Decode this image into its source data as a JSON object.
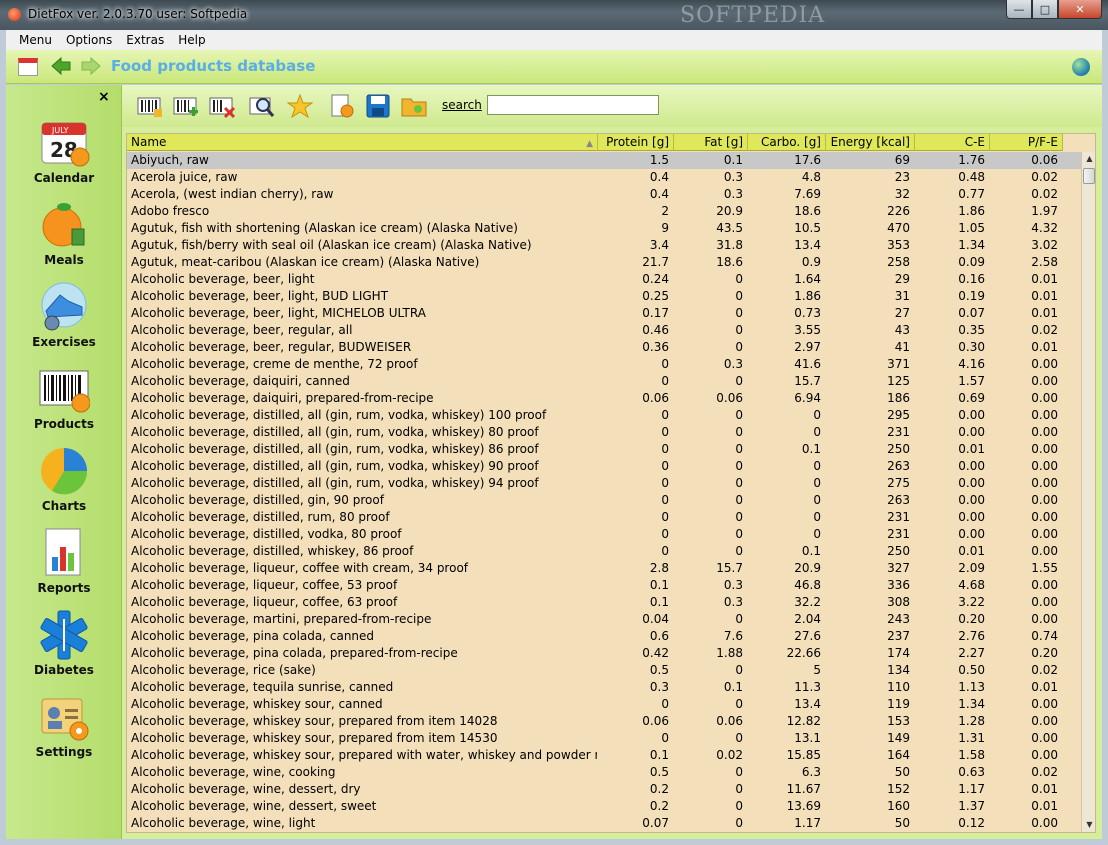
{
  "window": {
    "title": "DietFox  ver. 2.0.3.70 user: Softpedia",
    "watermark": "SOFTPEDIA",
    "buttons": {
      "minimize": "—",
      "maximize": "□",
      "close": "✕"
    }
  },
  "menu": [
    "Menu",
    "Options",
    "Extras",
    "Help"
  ],
  "header": {
    "title": "Food products database"
  },
  "sidebar": {
    "close": "×",
    "items": [
      {
        "label": "Calendar",
        "icon": "calendar-icon"
      },
      {
        "label": "Meals",
        "icon": "orange-icon"
      },
      {
        "label": "Exercises",
        "icon": "shoe-icon"
      },
      {
        "label": "Products",
        "icon": "barcode-icon"
      },
      {
        "label": "Charts",
        "icon": "pie-chart-icon"
      },
      {
        "label": "Reports",
        "icon": "report-icon"
      },
      {
        "label": "Diabetes",
        "icon": "medical-star-icon"
      },
      {
        "label": "Settings",
        "icon": "settings-icon"
      }
    ]
  },
  "toolbar": {
    "search_label": "search",
    "search_value": ""
  },
  "table": {
    "columns": [
      "Name",
      "Protein [g]",
      "Fat [g]",
      "Carbo. [g]",
      "Energy [kcal]",
      "C-E",
      "P/F-E"
    ],
    "rows": [
      [
        "Abiyuch, raw",
        "1.5",
        "0.1",
        "17.6",
        "69",
        "1.76",
        "0.06"
      ],
      [
        "Acerola juice, raw",
        "0.4",
        "0.3",
        "4.8",
        "23",
        "0.48",
        "0.02"
      ],
      [
        "Acerola, (west indian cherry), raw",
        "0.4",
        "0.3",
        "7.69",
        "32",
        "0.77",
        "0.02"
      ],
      [
        "Adobo fresco",
        "2",
        "20.9",
        "18.6",
        "226",
        "1.86",
        "1.97"
      ],
      [
        "Agutuk, fish with shortening (Alaskan ice cream) (Alaska Native)",
        "9",
        "43.5",
        "10.5",
        "470",
        "1.05",
        "4.32"
      ],
      [
        "Agutuk, fish/berry with seal oil (Alaskan ice cream) (Alaska Native)",
        "3.4",
        "31.8",
        "13.4",
        "353",
        "1.34",
        "3.02"
      ],
      [
        "Agutuk, meat-caribou (Alaskan ice cream) (Alaska Native)",
        "21.7",
        "18.6",
        "0.9",
        "258",
        "0.09",
        "2.58"
      ],
      [
        "Alcoholic beverage, beer, light",
        "0.24",
        "0",
        "1.64",
        "29",
        "0.16",
        "0.01"
      ],
      [
        "Alcoholic beverage, beer, light, BUD LIGHT",
        "0.25",
        "0",
        "1.86",
        "31",
        "0.19",
        "0.01"
      ],
      [
        "Alcoholic beverage, beer, light, MICHELOB ULTRA",
        "0.17",
        "0",
        "0.73",
        "27",
        "0.07",
        "0.01"
      ],
      [
        "Alcoholic beverage, beer, regular, all",
        "0.46",
        "0",
        "3.55",
        "43",
        "0.35",
        "0.02"
      ],
      [
        "Alcoholic beverage, beer, regular, BUDWEISER",
        "0.36",
        "0",
        "2.97",
        "41",
        "0.30",
        "0.01"
      ],
      [
        "Alcoholic beverage, creme de menthe, 72 proof",
        "0",
        "0.3",
        "41.6",
        "371",
        "4.16",
        "0.00"
      ],
      [
        "Alcoholic beverage, daiquiri, canned",
        "0",
        "0",
        "15.7",
        "125",
        "1.57",
        "0.00"
      ],
      [
        "Alcoholic beverage, daiquiri, prepared-from-recipe",
        "0.06",
        "0.06",
        "6.94",
        "186",
        "0.69",
        "0.00"
      ],
      [
        "Alcoholic beverage, distilled, all (gin, rum, vodka, whiskey) 100 proof",
        "0",
        "0",
        "0",
        "295",
        "0.00",
        "0.00"
      ],
      [
        "Alcoholic beverage, distilled, all (gin, rum, vodka, whiskey) 80 proof",
        "0",
        "0",
        "0",
        "231",
        "0.00",
        "0.00"
      ],
      [
        "Alcoholic beverage, distilled, all (gin, rum, vodka, whiskey) 86 proof",
        "0",
        "0",
        "0.1",
        "250",
        "0.01",
        "0.00"
      ],
      [
        "Alcoholic beverage, distilled, all (gin, rum, vodka, whiskey) 90 proof",
        "0",
        "0",
        "0",
        "263",
        "0.00",
        "0.00"
      ],
      [
        "Alcoholic beverage, distilled, all (gin, rum, vodka, whiskey) 94 proof",
        "0",
        "0",
        "0",
        "275",
        "0.00",
        "0.00"
      ],
      [
        "Alcoholic beverage, distilled, gin, 90 proof",
        "0",
        "0",
        "0",
        "263",
        "0.00",
        "0.00"
      ],
      [
        "Alcoholic beverage, distilled, rum, 80 proof",
        "0",
        "0",
        "0",
        "231",
        "0.00",
        "0.00"
      ],
      [
        "Alcoholic beverage, distilled, vodka, 80 proof",
        "0",
        "0",
        "0",
        "231",
        "0.00",
        "0.00"
      ],
      [
        "Alcoholic beverage, distilled, whiskey, 86 proof",
        "0",
        "0",
        "0.1",
        "250",
        "0.01",
        "0.00"
      ],
      [
        "Alcoholic beverage, liqueur, coffee with cream, 34 proof",
        "2.8",
        "15.7",
        "20.9",
        "327",
        "2.09",
        "1.55"
      ],
      [
        "Alcoholic beverage, liqueur, coffee, 53 proof",
        "0.1",
        "0.3",
        "46.8",
        "336",
        "4.68",
        "0.00"
      ],
      [
        "Alcoholic beverage, liqueur, coffee, 63 proof",
        "0.1",
        "0.3",
        "32.2",
        "308",
        "3.22",
        "0.00"
      ],
      [
        "Alcoholic beverage, martini, prepared-from-recipe",
        "0.04",
        "0",
        "2.04",
        "243",
        "0.20",
        "0.00"
      ],
      [
        "Alcoholic beverage, pina colada, canned",
        "0.6",
        "7.6",
        "27.6",
        "237",
        "2.76",
        "0.74"
      ],
      [
        "Alcoholic beverage, pina colada, prepared-from-recipe",
        "0.42",
        "1.88",
        "22.66",
        "174",
        "2.27",
        "0.20"
      ],
      [
        "Alcoholic beverage, rice (sake)",
        "0.5",
        "0",
        "5",
        "134",
        "0.50",
        "0.02"
      ],
      [
        "Alcoholic beverage, tequila sunrise, canned",
        "0.3",
        "0.1",
        "11.3",
        "110",
        "1.13",
        "0.01"
      ],
      [
        "Alcoholic beverage, whiskey sour, canned",
        "0",
        "0",
        "13.4",
        "119",
        "1.34",
        "0.00"
      ],
      [
        "Alcoholic beverage, whiskey sour, prepared from item 14028",
        "0.06",
        "0.06",
        "12.82",
        "153",
        "1.28",
        "0.00"
      ],
      [
        "Alcoholic beverage, whiskey sour, prepared from item 14530",
        "0",
        "0",
        "13.1",
        "149",
        "1.31",
        "0.00"
      ],
      [
        "Alcoholic beverage, whiskey sour, prepared with water, whiskey and powder mix",
        "0.1",
        "0.02",
        "15.85",
        "164",
        "1.58",
        "0.00"
      ],
      [
        "Alcoholic beverage, wine, cooking",
        "0.5",
        "0",
        "6.3",
        "50",
        "0.63",
        "0.02"
      ],
      [
        "Alcoholic beverage, wine, dessert, dry",
        "0.2",
        "0",
        "11.67",
        "152",
        "1.17",
        "0.01"
      ],
      [
        "Alcoholic beverage, wine, dessert, sweet",
        "0.2",
        "0",
        "13.69",
        "160",
        "1.37",
        "0.01"
      ],
      [
        "Alcoholic beverage, wine, light",
        "0.07",
        "0",
        "1.17",
        "50",
        "0.12",
        "0.00"
      ]
    ]
  }
}
